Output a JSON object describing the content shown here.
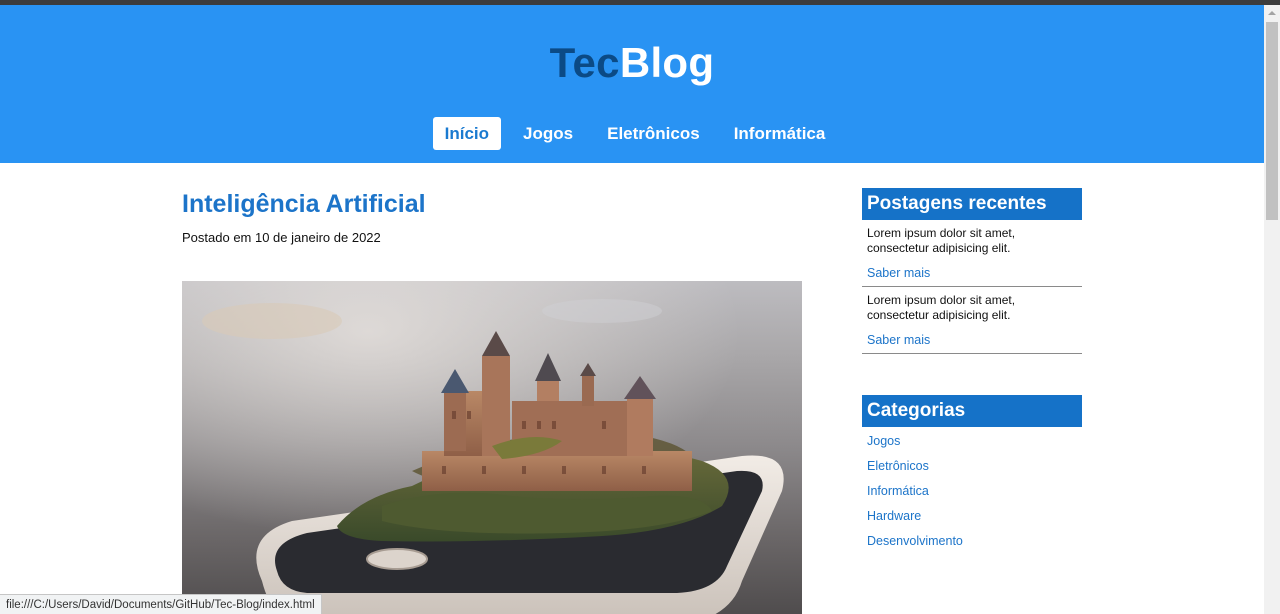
{
  "header": {
    "logo_part1": "Tec",
    "logo_part2": "Blog"
  },
  "nav": {
    "items": [
      {
        "label": "Início",
        "active": true
      },
      {
        "label": "Jogos",
        "active": false
      },
      {
        "label": "Eletrônicos",
        "active": false
      },
      {
        "label": "Informática",
        "active": false
      }
    ]
  },
  "post": {
    "title": "Inteligência Artificial",
    "meta": "Postado em 10 de janeiro de 2022"
  },
  "sidebar": {
    "recent_title": "Postagens recentes",
    "recent_items": [
      {
        "text": "Lorem ipsum dolor sit amet, consectetur adipisicing elit.",
        "link": "Saber mais"
      },
      {
        "text": "Lorem ipsum dolor sit amet, consectetur adipisicing elit.",
        "link": "Saber mais"
      }
    ],
    "categories_title": "Categorias",
    "categories": [
      "Jogos",
      "Eletrônicos",
      "Informática",
      "Hardware",
      "Desenvolvimento"
    ]
  },
  "status_bar": {
    "url": "file:///C:/Users/David/Documents/GitHub/Tec-Blog/index.html"
  },
  "colors": {
    "header_bg": "#2993f3",
    "accent": "#1c74c9",
    "sidebar_head": "#1572c8"
  }
}
